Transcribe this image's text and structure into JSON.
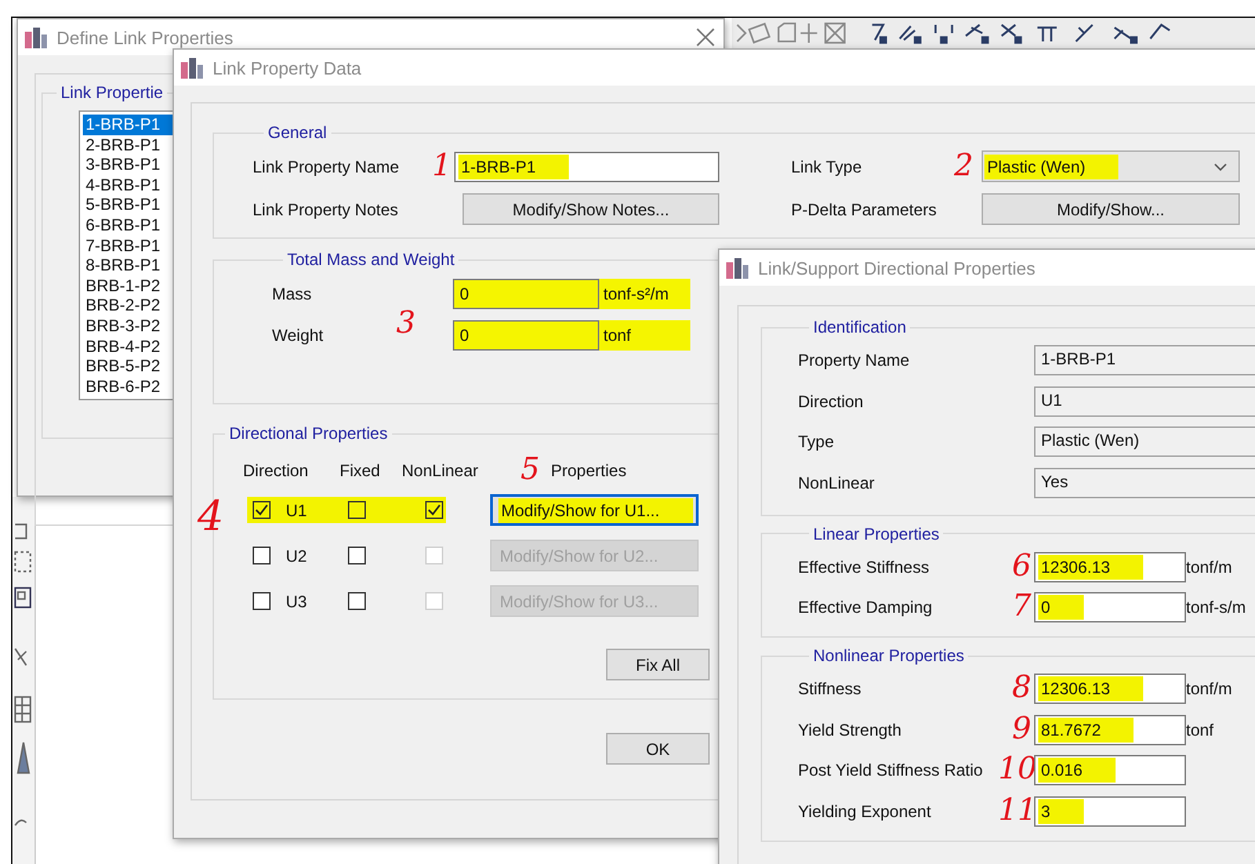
{
  "define_window": {
    "title": "Define Link Properties",
    "group_label": "Link Propertie",
    "items": [
      {
        "label": "1-BRB-P1",
        "selected": true
      },
      {
        "label": "2-BRB-P1",
        "selected": false
      },
      {
        "label": "3-BRB-P1",
        "selected": false
      },
      {
        "label": "4-BRB-P1",
        "selected": false
      },
      {
        "label": "5-BRB-P1",
        "selected": false
      },
      {
        "label": "6-BRB-P1",
        "selected": false
      },
      {
        "label": "7-BRB-P1",
        "selected": false
      },
      {
        "label": "8-BRB-P1",
        "selected": false
      },
      {
        "label": "BRB-1-P2",
        "selected": false
      },
      {
        "label": "BRB-2-P2",
        "selected": false
      },
      {
        "label": "BRB-3-P2",
        "selected": false
      },
      {
        "label": "BRB-4-P2",
        "selected": false
      },
      {
        "label": "BRB-5-P2",
        "selected": false
      },
      {
        "label": "BRB-6-P2",
        "selected": false
      }
    ]
  },
  "data_window": {
    "title": "Link Property Data",
    "general": {
      "title": "General",
      "name": {
        "label": "Link Property Name",
        "note": "1",
        "value": "1-BRB-P1",
        "highlighted": true
      },
      "notes": {
        "label": "Link Property Notes",
        "button": "Modify/Show Notes..."
      },
      "link_type": {
        "label": "Link Type",
        "note": "2",
        "value": "Plastic (Wen)",
        "highlighted": true
      },
      "p_delta": {
        "label": "P-Delta Parameters",
        "button": "Modify/Show..."
      }
    },
    "mass": {
      "title": "Total Mass and Weight",
      "note": "3",
      "rows": [
        {
          "label": "Mass",
          "value": "0",
          "unit": "tonf-s²/m",
          "highlighted": true
        },
        {
          "label": "Weight",
          "value": "0",
          "unit": "tonf",
          "highlighted": true
        }
      ]
    },
    "directional": {
      "title": "Directional Properties",
      "row_note": "4",
      "properties_note": "5",
      "headers": {
        "direction": "Direction",
        "fixed": "Fixed",
        "nonlinear": "NonLinear",
        "properties": "Properties"
      },
      "rows": [
        {
          "direction": "U1",
          "checked": true,
          "fixed": false,
          "nonlinear": true,
          "nonlinear_disabled": false,
          "button": "Modify/Show for U1...",
          "button_disabled": false,
          "highlighted": true
        },
        {
          "direction": "U2",
          "checked": false,
          "fixed": false,
          "nonlinear": false,
          "nonlinear_disabled": true,
          "button": "Modify/Show for U2...",
          "button_disabled": true,
          "highlighted": false
        },
        {
          "direction": "U3",
          "checked": false,
          "fixed": false,
          "nonlinear": false,
          "nonlinear_disabled": true,
          "button": "Modify/Show for U3...",
          "button_disabled": true,
          "highlighted": false
        }
      ],
      "fix_all": "Fix All"
    },
    "ok": "OK"
  },
  "directional_window": {
    "title": "Link/Support Directional Properties",
    "identification": {
      "title": "Identification",
      "rows": [
        {
          "label": "Property Name",
          "value": "1-BRB-P1"
        },
        {
          "label": "Direction",
          "value": "U1"
        },
        {
          "label": "Type",
          "value": "Plastic (Wen)"
        },
        {
          "label": "NonLinear",
          "value": "Yes"
        }
      ]
    },
    "linear": {
      "title": "Linear Properties",
      "rows": [
        {
          "label": "Effective Stiffness",
          "note": "6",
          "value": "12306.13",
          "unit": "tonf/m",
          "highlighted": true
        },
        {
          "label": "Effective Damping",
          "note": "7",
          "value": "0",
          "unit": "tonf-s/m",
          "highlighted": true
        }
      ]
    },
    "nonlinear": {
      "title": "Nonlinear Properties",
      "rows": [
        {
          "label": "Stiffness",
          "note": "8",
          "value": "12306.13",
          "unit": "tonf/m",
          "highlighted": true
        },
        {
          "label": "Yield Strength",
          "note": "9",
          "value": "81.7672",
          "unit": "tonf",
          "highlighted": true
        },
        {
          "label": "Post Yield Stiffness Ratio",
          "note": "10",
          "value": "0.016",
          "highlighted": true
        },
        {
          "label": "Yielding Exponent",
          "note": "11",
          "value": "3",
          "highlighted": true
        }
      ]
    }
  }
}
